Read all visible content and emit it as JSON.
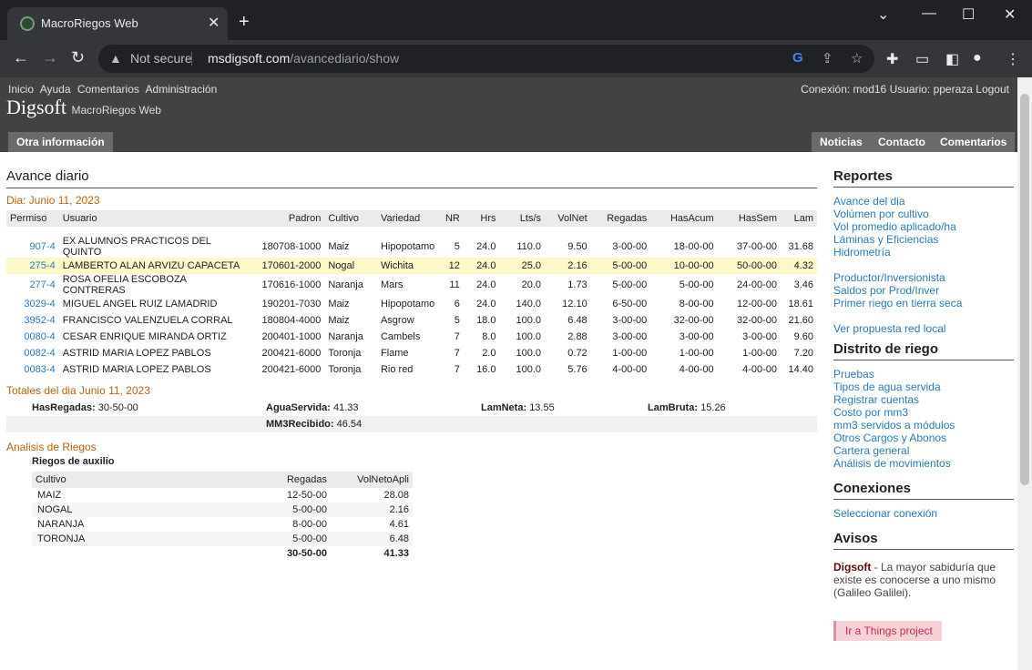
{
  "browser": {
    "tab_title": "MacroRiegos Web",
    "not_secure": "Not secure",
    "url_host": "msdigsoft.com",
    "url_path": "/avancediario/show"
  },
  "header": {
    "nav": [
      "Inicio",
      "Ayuda",
      "Comentarios",
      "Administración"
    ],
    "user_info": "Conexión: mod16  Usuario: pperaza  Logout",
    "brand": "Digsoft",
    "brand_sub": "MacroRiegos Web",
    "left_tab": "Otra información",
    "right_tabs": [
      "Noticias",
      "Contacto",
      "Comentarios"
    ]
  },
  "main": {
    "title": "Avance diario",
    "date_label": "Dia: Junio 11, 2023",
    "columns": [
      "Permiso",
      "Usuario",
      "Padron",
      "Cultivo",
      "Variedad",
      "NR",
      "Hrs",
      "Lts/s",
      "VolNet",
      "Regadas",
      "HasAcum",
      "HasSem",
      "Lam"
    ],
    "rows": [
      [
        "907-4",
        "EX ALUMNOS PRACTICOS DEL QUINTO",
        "180708-1000",
        "Maiz",
        "Hipopotamo",
        "5",
        "24.0",
        "110.0",
        "9.50",
        "3-00-00",
        "18-00-00",
        "37-00-00",
        "31.68"
      ],
      [
        "275-4",
        "LAMBERTO ALAN ARVIZU CAPACETA",
        "170601-2000",
        "Nogal",
        "Wichita",
        "12",
        "24.0",
        "25.0",
        "2.16",
        "5-00-00",
        "10-00-00",
        "50-00-00",
        "4.32"
      ],
      [
        "277-4",
        "ROSA OFELIA ESCOBOZA CONTRERAS",
        "170616-1000",
        "Naranja",
        "Mars",
        "11",
        "24.0",
        "20.0",
        "1.73",
        "5-00-00",
        "5-00-00",
        "24-00-00",
        "3.46"
      ],
      [
        "3029-4",
        "MIGUEL ANGEL RUIZ LAMADRID",
        "190201-7030",
        "Maiz",
        "Hipopotamo",
        "6",
        "24.0",
        "140.0",
        "12.10",
        "6-50-00",
        "8-00-00",
        "12-00-00",
        "18.61"
      ],
      [
        "3952-4",
        "FRANCISCO VALENZUELA CORRAL",
        "180804-4000",
        "Maiz",
        "Asgrow",
        "5",
        "18.0",
        "100.0",
        "6.48",
        "3-00-00",
        "32-00-00",
        "32-00-00",
        "21.60"
      ],
      [
        "0080-4",
        "CESAR ENRIQUE MIRANDA ORTIZ",
        "200401-1000",
        "Naranja",
        "Cambels",
        "7",
        "8.0",
        "100.0",
        "2.88",
        "3-00-00",
        "3-00-00",
        "3-00-00",
        "9.60"
      ],
      [
        "0082-4",
        "ASTRID MARIA LOPEZ PABLOS",
        "200421-6000",
        "Toronja",
        "Flame",
        "7",
        "2.0",
        "100.0",
        "0.72",
        "1-00-00",
        "1-00-00",
        "1-00-00",
        "7.20"
      ],
      [
        "0083-4",
        "ASTRID MARIA LOPEZ PABLOS",
        "200421-6000",
        "Toronja",
        "Rio red",
        "7",
        "16.0",
        "100.0",
        "5.76",
        "4-00-00",
        "4-00-00",
        "4-00-00",
        "14.40"
      ]
    ],
    "totals_title": "Totales del dia Junio 11, 2023",
    "totals": {
      "has_regadas_label": "HasRegadas:",
      "has_regadas": "30-50-00",
      "agua_label": "AguaServida:",
      "agua": "41.33",
      "lamneta_label": "LamNeta:",
      "lamneta": "13.55",
      "lambruta_label": "LamBruta:",
      "lambruta": "15.26",
      "mm3_label": "MM3Recibido:",
      "mm3": "46.54"
    },
    "analisis_title": "Analisis de Riegos",
    "riegos_label": "Riegos de auxilio",
    "analisis_cols": [
      "Cultivo",
      "Regadas",
      "VolNetoApli"
    ],
    "analisis_rows": [
      [
        "MAIZ",
        "12-50-00",
        "28.08"
      ],
      [
        "NOGAL",
        "5-00-00",
        "2.16"
      ],
      [
        "NARANJA",
        "8-00-00",
        "4.61"
      ],
      [
        "TORONJA",
        "5-00-00",
        "6.48"
      ]
    ],
    "analisis_total": [
      "",
      "30-50-00",
      "41.33"
    ]
  },
  "sidebar": {
    "reportes_title": "Reportes",
    "reportes_a": [
      "Avance del dia",
      "Volúmen por cultivo",
      "Vol promedio aplicado/ha",
      "Láminas y Eficiencias",
      "Hidrometría"
    ],
    "reportes_b": [
      "Productor/Inversionista",
      "Saldos por Prod/Inver",
      "Primer riego en tierra seca"
    ],
    "reportes_c": [
      "Ver propuesta red local"
    ],
    "distrito_title": "Distrito de riego",
    "distrito": [
      "Pruebas",
      "Tipos de agua servida",
      "Registrar cuentas",
      "Costo por mm3",
      "mm3 servidos a módulos",
      "Otros Cargos y Abonos",
      "Cartera general",
      "Análisis de movimientos"
    ],
    "conexiones_title": "Conexiones",
    "conexiones": [
      "Seleccionar conexión"
    ],
    "avisos_title": "Avisos",
    "aviso_brand": "Digsoft",
    "aviso_text": " - La mayor sabiduría que existe es conocerse a uno mismo (Galileo Galilei).",
    "things_button": "Ir a Things project"
  }
}
